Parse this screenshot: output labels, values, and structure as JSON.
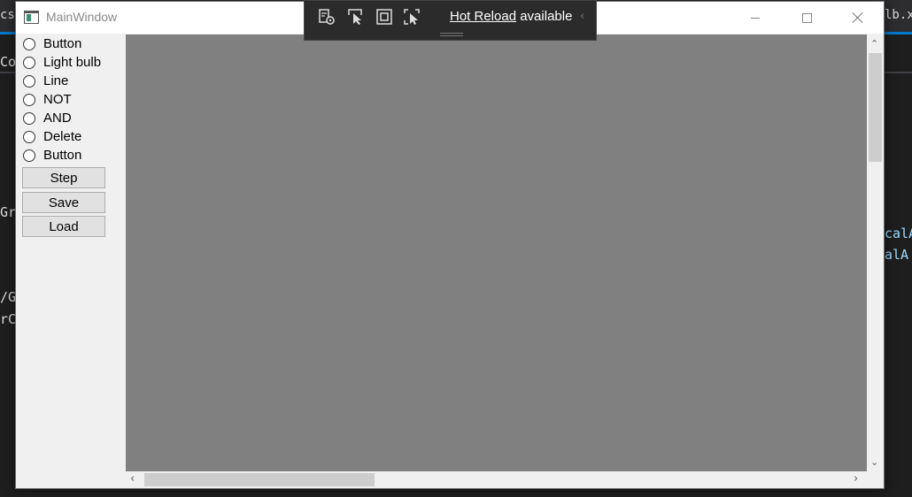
{
  "window": {
    "title": "MainWindow"
  },
  "hot_reload": {
    "link_text": "Hot Reload",
    "status_text": "available"
  },
  "left_panel": {
    "radio_options": [
      {
        "label": "Button"
      },
      {
        "label": "Light bulb"
      },
      {
        "label": "Line"
      },
      {
        "label": "NOT"
      },
      {
        "label": "AND"
      },
      {
        "label": "Delete"
      },
      {
        "label": "Button"
      }
    ],
    "buttons": {
      "step": "Step",
      "save": "Save",
      "load": "Load"
    }
  },
  "background_ide": {
    "tab_left": "cs",
    "tab_right": "lb.xa",
    "fragments": [
      "Co",
      "Gr",
      "/G",
      "rC",
      "calA",
      "alA"
    ]
  },
  "colors": {
    "canvas": "#808080",
    "window_bg": "#f0f0f0",
    "ide_bg": "#1e1e1e",
    "ide_accent": "#007acc"
  }
}
